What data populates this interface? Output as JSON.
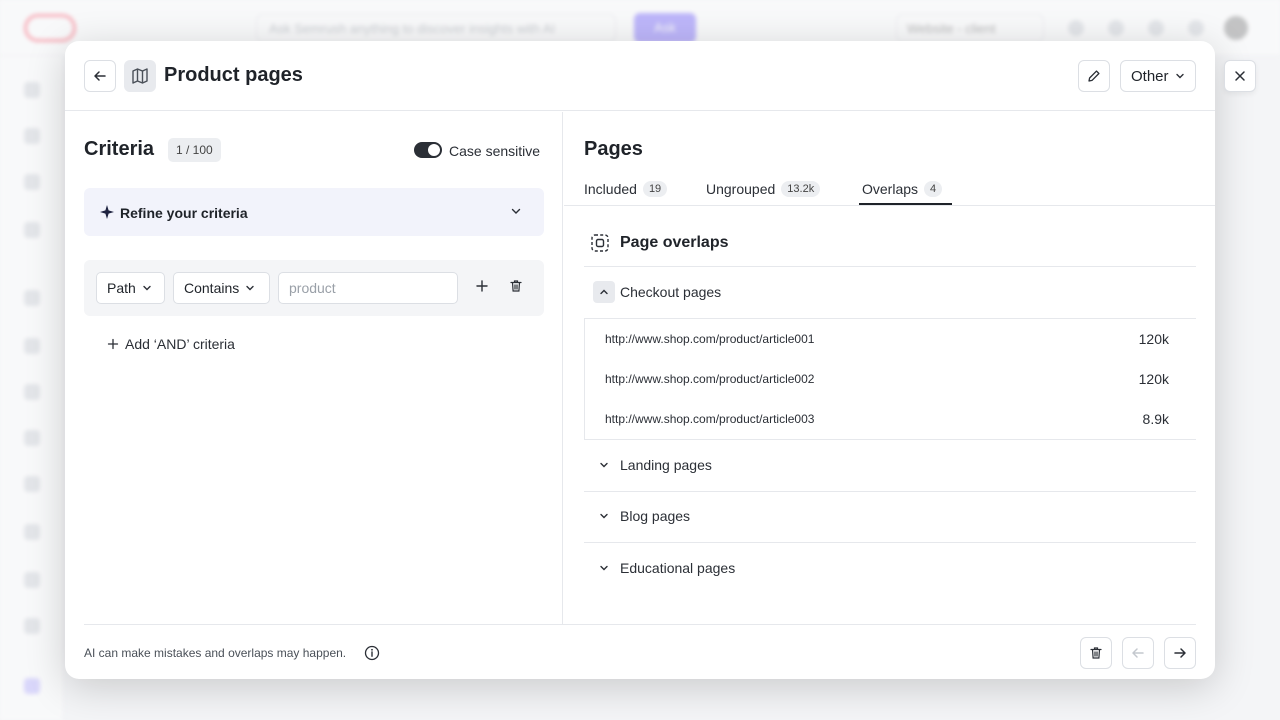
{
  "background": {
    "search_placeholder": "Ask Semrush anything to discover insights with AI",
    "ask_label": "Ask",
    "site_selector": "Website - client"
  },
  "modal": {
    "title": "Product pages",
    "other_label": "Other"
  },
  "criteria": {
    "title": "Criteria",
    "count": "1 / 100",
    "case_sensitive_label": "Case sensitive",
    "case_sensitive_on": true,
    "refine_label": "Refine your criteria",
    "path_label": "Path",
    "operator_label": "Contains",
    "value_placeholder": "product",
    "add_and_label": "Add ‘AND’ criteria"
  },
  "pages": {
    "title": "Pages",
    "tabs": [
      {
        "label": "Included",
        "count": "19"
      },
      {
        "label": "Ungrouped",
        "count": "13.2k"
      },
      {
        "label": "Overlaps",
        "count": "4"
      }
    ],
    "active_tab": "Overlaps",
    "overlaps_title": "Page overlaps",
    "groups": [
      {
        "label": "Checkout pages",
        "expanded": true
      },
      {
        "label": "Landing pages",
        "expanded": false
      },
      {
        "label": "Blog pages",
        "expanded": false
      },
      {
        "label": "Educational pages",
        "expanded": false
      }
    ],
    "urls": [
      {
        "url": "http://www.shop.com/product/article001",
        "value": "120k"
      },
      {
        "url": "http://www.shop.com/product/article002",
        "value": "120k"
      },
      {
        "url": "http://www.shop.com/product/article003",
        "value": "8.9k"
      }
    ]
  },
  "footer": {
    "disclaimer": "AI can make mistakes and overlaps may happen."
  },
  "colors": {
    "accent": "#7c6bff",
    "text": "#1f2329",
    "border": "#e6e8ec"
  }
}
